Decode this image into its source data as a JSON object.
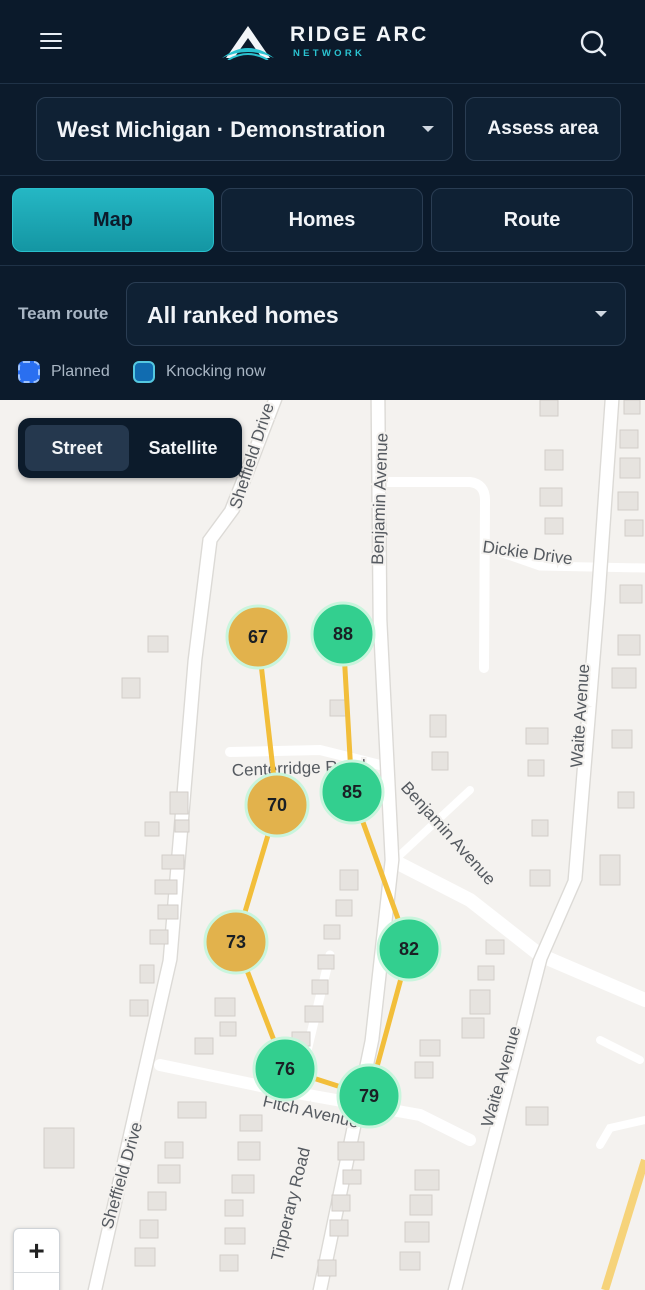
{
  "brand": {
    "name": "RIDGE ARC",
    "sub": "NETWORK"
  },
  "header": {
    "menu_icon": "hamburger-menu-icon",
    "search_icon": "search-icon"
  },
  "region": {
    "value": "West Michigan · Demonstration",
    "assess_label": "Assess area"
  },
  "tabs": [
    {
      "label": "Map",
      "active": true
    },
    {
      "label": "Homes",
      "active": false
    },
    {
      "label": "Route",
      "active": false
    }
  ],
  "route": {
    "label": "Team route",
    "value": "All ranked homes"
  },
  "legend": [
    {
      "label": "Planned",
      "color": "#2a6ff0"
    },
    {
      "label": "Knocking now",
      "color": "#116cb0"
    }
  ],
  "map_toggle": {
    "street": "Street",
    "satellite": "Satellite",
    "active": "Street"
  },
  "streets": {
    "sheffield_top": "Sheffield Drive",
    "sheffield_bottom": "Sheffield Drive",
    "benjamin_top": "Benjamin Avenue",
    "benjamin_diag": "Benjamin Avenue",
    "dickie": "Dickie Drive",
    "centerridge": "Centerridge Road",
    "waite_top": "Waite Avenue",
    "waite_bottom": "Waite Avenue",
    "fitch": "Fitch Avenue",
    "tipperary": "Tipperary Road"
  },
  "markers": [
    {
      "score": "67",
      "status": "planned"
    },
    {
      "score": "88",
      "status": "ranked"
    },
    {
      "score": "70",
      "status": "planned"
    },
    {
      "score": "85",
      "status": "ranked"
    },
    {
      "score": "73",
      "status": "planned"
    },
    {
      "score": "82",
      "status": "ranked"
    },
    {
      "score": "76",
      "status": "ranked"
    },
    {
      "score": "79",
      "status": "ranked"
    }
  ],
  "colors": {
    "planned_marker": "#e2b24c",
    "ranked_marker": "#33cf8f",
    "route_line": "#f2be3a",
    "accent": "#25b7c4"
  },
  "zoom": {
    "in_label": "+"
  }
}
